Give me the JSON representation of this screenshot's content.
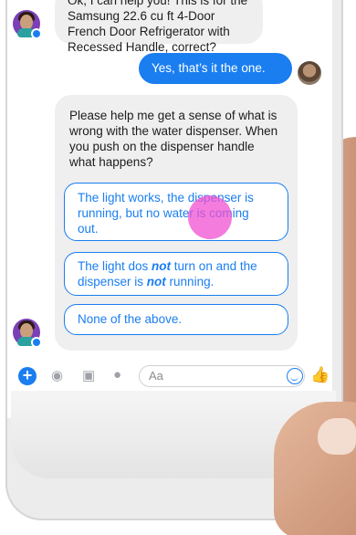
{
  "messages": {
    "bot_msg_1_lines": [
      "Ok, I can help you! This is for the",
      "Samsung 22.6 cu ft 4-Door",
      "French Door Refrigerator with",
      "Recessed Handle, correct?"
    ],
    "user_reply": "Yes, that’s it the one.",
    "bot_msg_2_lines": [
      "Please help me get a sense of what is",
      "wrong with the water dispenser. When",
      "you push on the dispenser handle",
      "what happens?"
    ]
  },
  "quick_replies": {
    "option_1_lines": [
      "The light works, the dispenser is",
      "running, but no water is coming",
      "out."
    ],
    "option_2_part1": "The light dos ",
    "option_2_not1": "not",
    "option_2_part2": " turn on and the",
    "option_2_part3": "dispenser is ",
    "option_2_not2": "not",
    "option_2_part4": " running.",
    "option_3": "None of the above."
  },
  "composer": {
    "placeholder": "Aa",
    "plus_symbol": "+",
    "icons": [
      "camera-icon",
      "photo-icon",
      "microphone-icon",
      "emoji-icon",
      "like-icon"
    ]
  },
  "colors": {
    "accent": "#1a7ef0",
    "bubble_gray": "#efefef",
    "tap_indicator": "#f050d2"
  }
}
